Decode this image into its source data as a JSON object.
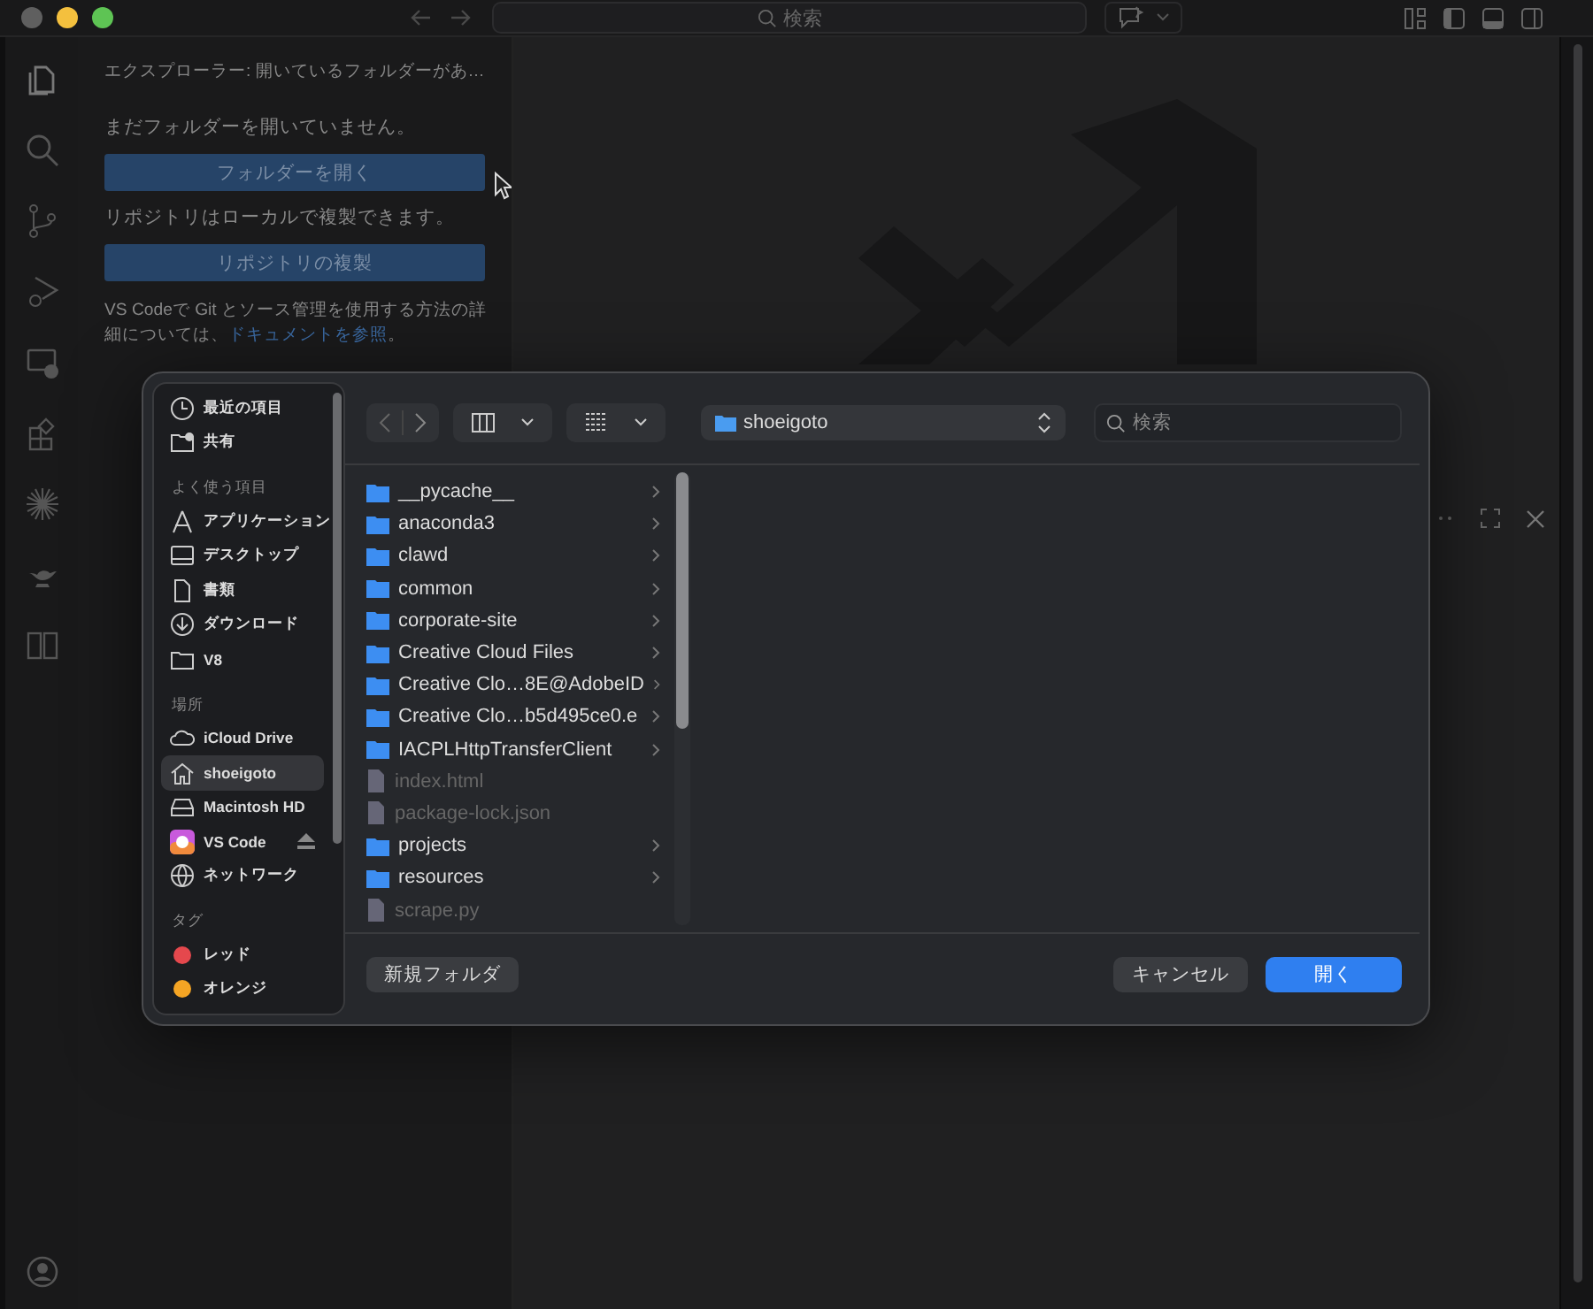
{
  "window": {
    "search": {
      "placeholder": "検索"
    }
  },
  "explorer": {
    "title": "エクスプローラー: 開いているフォルダーがあ…",
    "message": "まだフォルダーを開いていません。",
    "open_button": "フォルダーを開く",
    "clone_message": "リポジトリはローカルで複製できます。",
    "clone_button": "リポジトリの複製",
    "help": {
      "text": "VS Codeで Git とソース管理を使用する方法の詳細については、",
      "link": "ドキュメントを参照",
      "end": "。"
    }
  },
  "dialog": {
    "sidebar": [
      {
        "items": [
          {
            "label": "最近の項目",
            "kind": "clock",
            "selected": false
          },
          {
            "label": "共有",
            "kind": "shared",
            "selected": false
          }
        ]
      },
      {
        "heading": "よく使う項目",
        "items": [
          {
            "label": "アプリケーション",
            "kind": "apps",
            "selected": false
          },
          {
            "label": "デスクトップ",
            "kind": "desktop",
            "selected": false
          },
          {
            "label": "書類",
            "kind": "doc",
            "selected": false
          },
          {
            "label": "ダウンロード",
            "kind": "download",
            "selected": false
          },
          {
            "label": "V8",
            "kind": "folder",
            "selected": false
          }
        ]
      },
      {
        "heading": "場所",
        "items": [
          {
            "label": "iCloud Drive",
            "kind": "cloud",
            "selected": false
          },
          {
            "label": "shoeigoto",
            "kind": "home",
            "selected": true
          },
          {
            "label": "Macintosh HD",
            "kind": "disk",
            "selected": false
          },
          {
            "label": "VS Code",
            "kind": "removable",
            "selected": false
          },
          {
            "label": "ネットワーク",
            "kind": "network",
            "selected": false
          }
        ]
      },
      {
        "heading": "タグ",
        "items": [
          {
            "label": "レッド",
            "kind": "tag",
            "color": "#e5484d",
            "selected": false
          },
          {
            "label": "オレンジ",
            "kind": "tag",
            "color": "#f5a524",
            "selected": false
          }
        ]
      }
    ],
    "path": "shoeigoto",
    "search": {
      "placeholder": "検索"
    },
    "files": [
      {
        "name": "__pycache__",
        "kind": "folder",
        "disabled": false
      },
      {
        "name": "anaconda3",
        "kind": "folder",
        "disabled": false
      },
      {
        "name": "clawd",
        "kind": "folder",
        "disabled": false
      },
      {
        "name": "common",
        "kind": "folder",
        "disabled": false
      },
      {
        "name": "corporate-site",
        "kind": "folder",
        "disabled": false
      },
      {
        "name": "Creative Cloud Files",
        "kind": "folder",
        "disabled": false
      },
      {
        "name": "Creative Clo…8E@AdobeID",
        "kind": "folder",
        "disabled": false
      },
      {
        "name": "Creative Clo…b5d495ce0.e",
        "kind": "folder",
        "disabled": false
      },
      {
        "name": "IACPLHttpTransferClient",
        "kind": "folder",
        "disabled": false
      },
      {
        "name": "index.html",
        "kind": "file",
        "disabled": true
      },
      {
        "name": "package-lock.json",
        "kind": "file",
        "disabled": true
      },
      {
        "name": "projects",
        "kind": "folder",
        "disabled": false
      },
      {
        "name": "resources",
        "kind": "folder",
        "disabled": false
      },
      {
        "name": "scrape.py",
        "kind": "file",
        "disabled": true
      }
    ],
    "new_folder_button": "新規フォルダ",
    "cancel_button": "キャンセル",
    "open_button": "開く"
  }
}
